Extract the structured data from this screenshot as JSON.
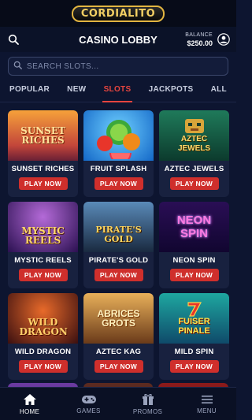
{
  "brand": {
    "logo_text": "CORDIALITO"
  },
  "header": {
    "title": "CASINO LOBBY",
    "balance_label": "BALANCE",
    "balance_amount": "$250.00"
  },
  "search": {
    "placeholder": "SEARCH SLOTS..."
  },
  "tabs": [
    {
      "label": "POPULAR",
      "active": false
    },
    {
      "label": "NEW",
      "active": false
    },
    {
      "label": "SLOTS",
      "active": true
    },
    {
      "label": "JACKPOTS",
      "active": false
    },
    {
      "label": "ALL",
      "active": false
    }
  ],
  "games": [
    {
      "name": "SUNSET RICHES",
      "art_text": "SUNSET RICHES",
      "icon": "sunset-desert-icon",
      "colors": [
        "#f6a13a",
        "#9b2f4a"
      ]
    },
    {
      "name": "FRUIT SPLASH",
      "art_text": "",
      "icon": "fruit-icon",
      "colors": [
        "#2aa6f0",
        "#1468c8"
      ]
    },
    {
      "name": "AZTEC JEWELS",
      "art_text": "AZTEC JEWELS",
      "icon": "aztec-mask-icon",
      "colors": [
        "#1f7a5a",
        "#0c3b2d"
      ]
    },
    {
      "name": "MYSTIC REELS",
      "art_text": "MYSTIC REELS",
      "icon": "sorceress-icon",
      "colors": [
        "#7a3aa8",
        "#2a1050"
      ]
    },
    {
      "name": "PIRATE'S GOLD",
      "art_text": "PIRATE'S GOLD",
      "icon": "pirate-icon",
      "colors": [
        "#3a6e9a",
        "#1a2a40"
      ]
    },
    {
      "name": "NEON SPIN",
      "art_text": "NEON SPIN",
      "icon": "neon-sign-icon",
      "colors": [
        "#2a0e55",
        "#110630"
      ]
    },
    {
      "name": "WILD DRAGON",
      "art_text": "WILD DRAGON",
      "icon": "dragon-icon",
      "colors": [
        "#c0381f",
        "#3a0f10"
      ]
    },
    {
      "name": "AZTEC KAG",
      "art_text": "ABRICES GROTS",
      "icon": "aztec-temple-icon",
      "colors": [
        "#d99a3a",
        "#6a3a1a"
      ]
    },
    {
      "name": "MILD SPIN",
      "art_text": "FUISER PINALE",
      "icon": "seven-icon",
      "colors": [
        "#1ea7a0",
        "#0f4a6a"
      ]
    }
  ],
  "play_label": "PLAY NOW",
  "next_row_colors": [
    "#6a3aa0",
    "#5a2a20",
    "#8a1a1a"
  ],
  "nav": [
    {
      "label": "HOME",
      "icon": "home-icon",
      "active": true
    },
    {
      "label": "GAMES",
      "icon": "gamepad-icon",
      "active": false
    },
    {
      "label": "PROMOS",
      "icon": "gift-icon",
      "active": false
    },
    {
      "label": "MENU",
      "icon": "hamburger-icon",
      "active": false
    }
  ]
}
